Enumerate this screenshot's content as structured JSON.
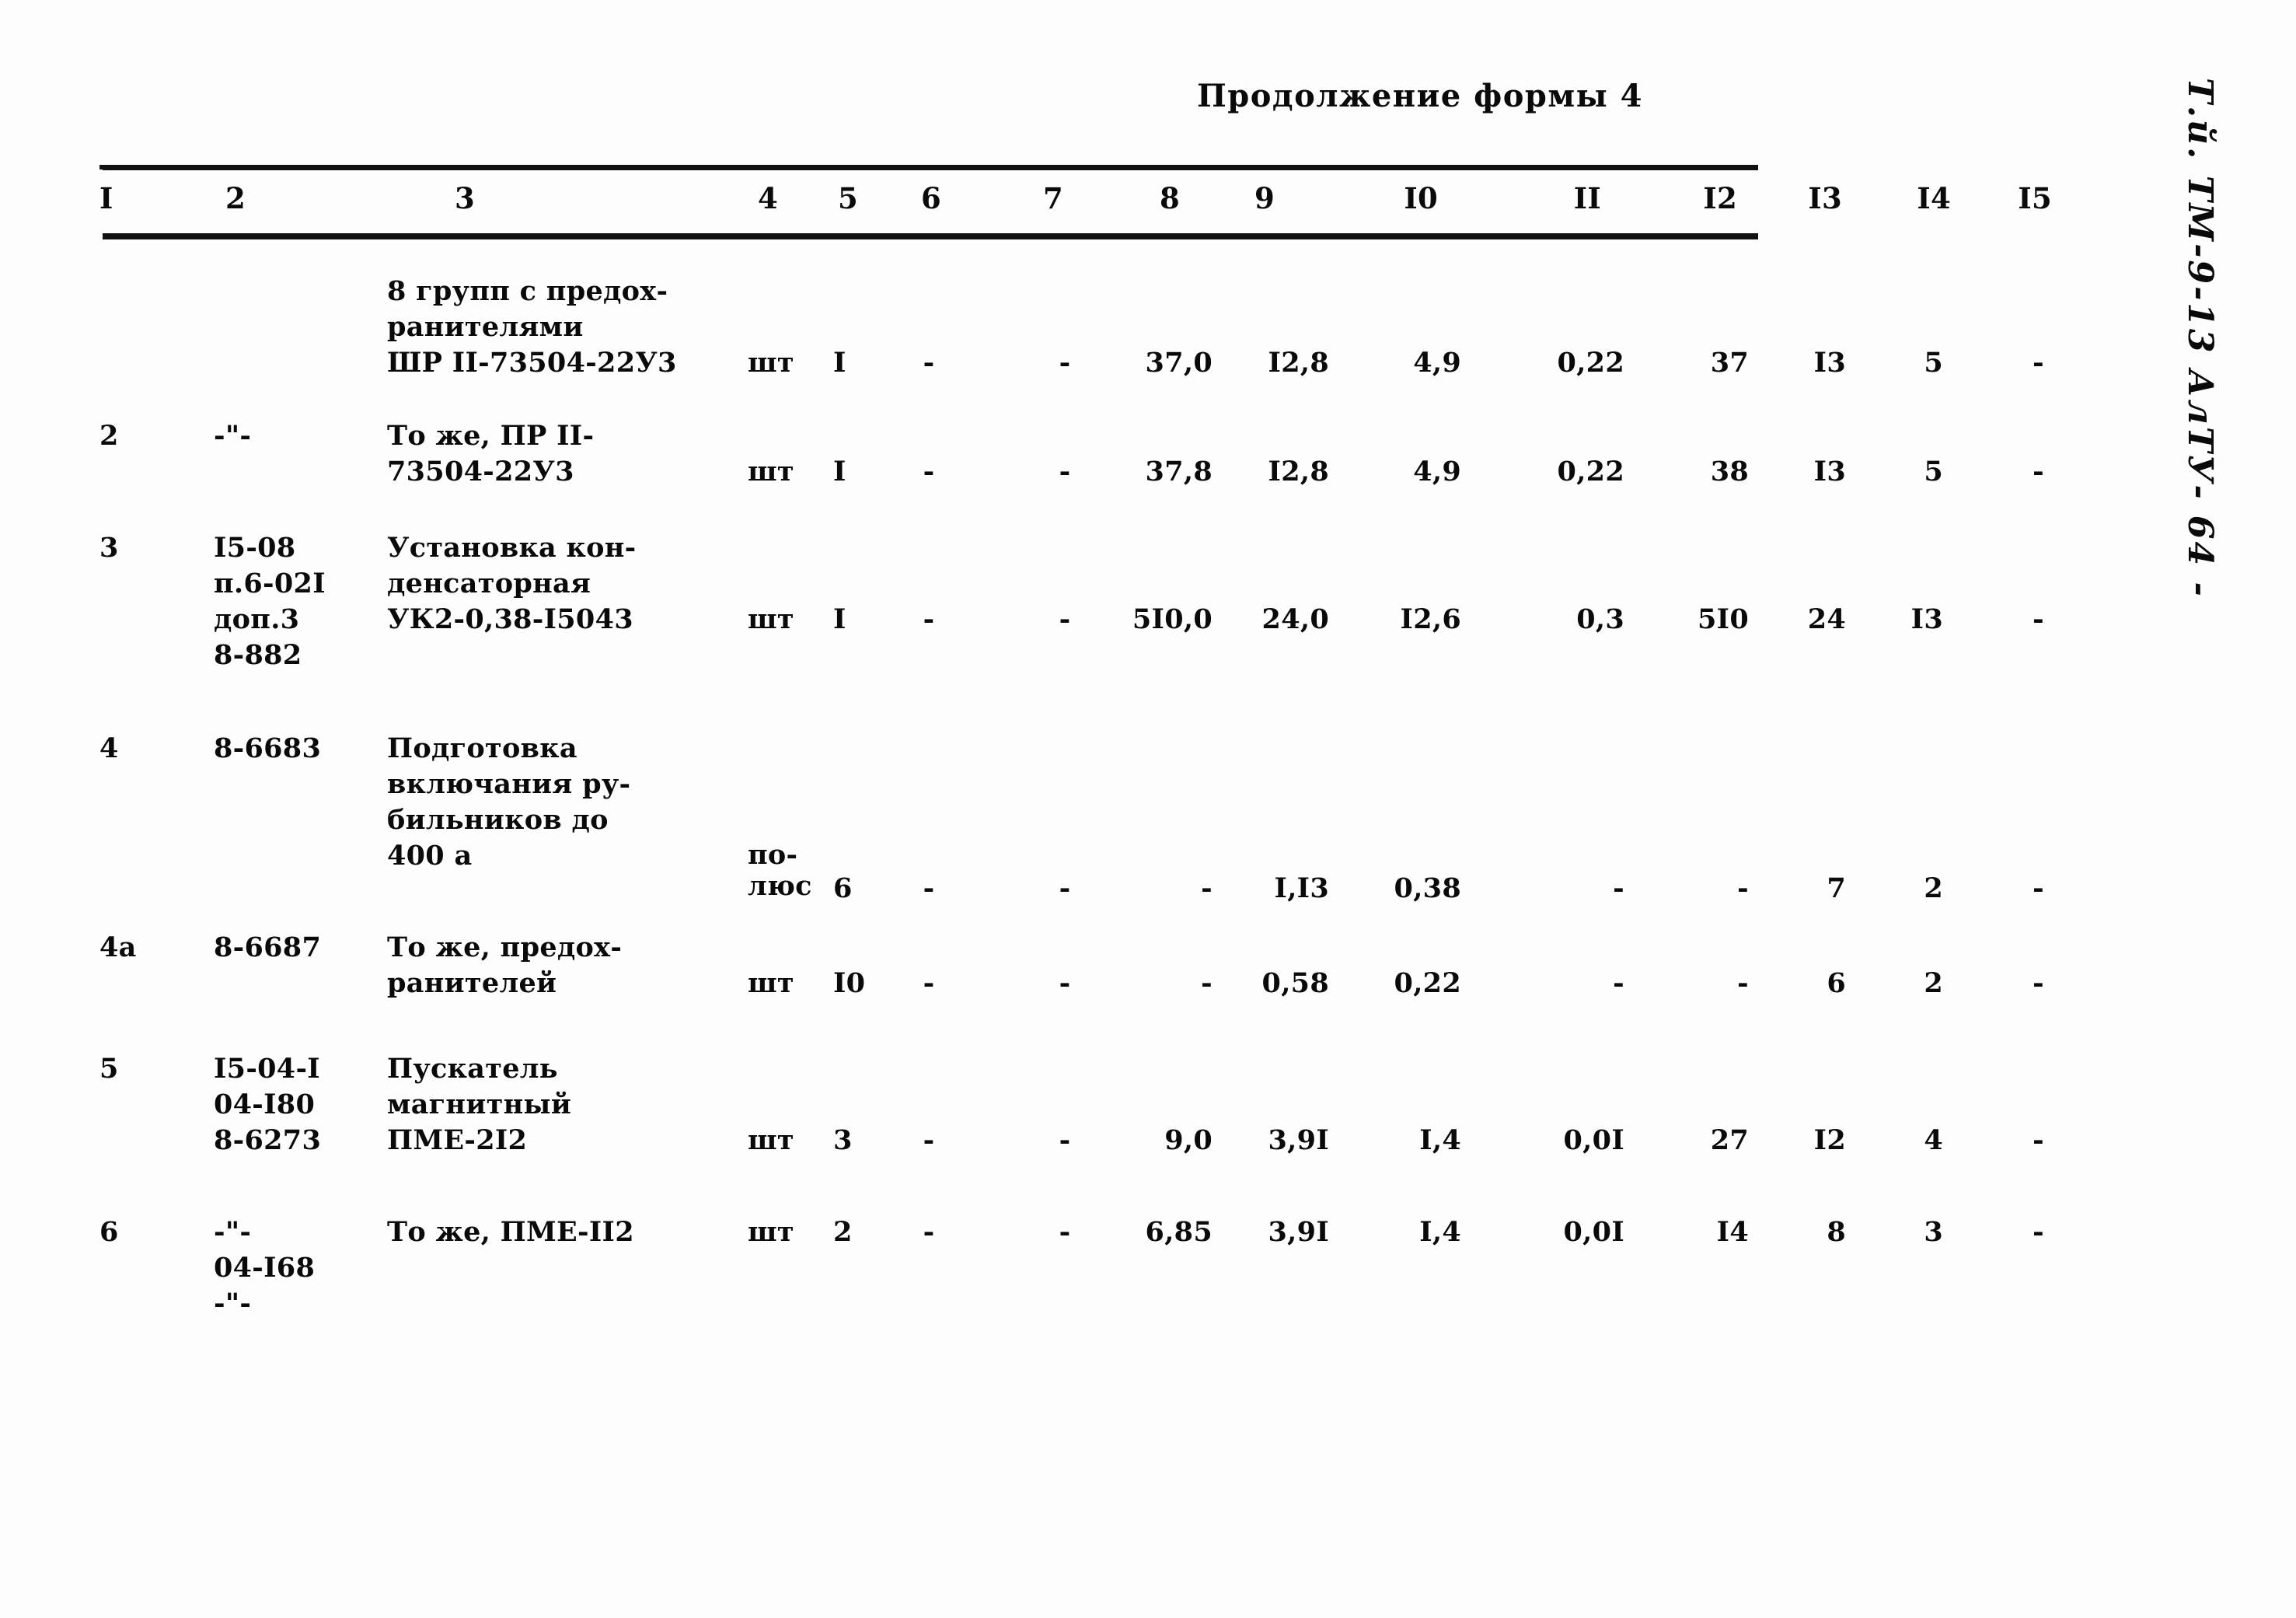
{
  "document": {
    "continuation_header": "Продолжение формы 4",
    "margin_note": "Т.й. ТМ-9-13  АлТУ- 64 -"
  },
  "table": {
    "column_numbers": [
      "I",
      "2",
      "3",
      "4",
      "5",
      "6",
      "7",
      "8",
      "9",
      "I0",
      "II",
      "I2",
      "I3",
      "I4",
      "I5"
    ],
    "rows": [
      {
        "c1": "",
        "c2": "",
        "c3": "8 групп с предох-\nранителями\nШР II-73504-22У3",
        "c4": "шт",
        "c5": "I",
        "c6": "-",
        "c7": "-",
        "c8": "37,0",
        "c9": "I2,8",
        "c10": "4,9",
        "c11": "0,22",
        "c12": "37",
        "c13": "I3",
        "c14": "5",
        "c15": "-"
      },
      {
        "c1": "2",
        "c2": "-\"-",
        "c3": "То же, ПР II-\n73504-22У3",
        "c4": "шт",
        "c5": "I",
        "c6": "-",
        "c7": "-",
        "c8": "37,8",
        "c9": "I2,8",
        "c10": "4,9",
        "c11": "0,22",
        "c12": "38",
        "c13": "I3",
        "c14": "5",
        "c15": "-"
      },
      {
        "c1": "3",
        "c2": "I5-08\nп.6-02I\nдоп.3\n8-882",
        "c3": "Установка кон-\nденсаторная\nУК2-0,38-I5043",
        "c4": "шт",
        "c5": "I",
        "c6": "-",
        "c7": "-",
        "c8": "5I0,0",
        "c9": "24,0",
        "c10": "I2,6",
        "c11": "0,3",
        "c12": "5I0",
        "c13": "24",
        "c14": "I3",
        "c15": "-"
      },
      {
        "c1": "4",
        "c2": "8-6683",
        "c3": "Подготовка\nвключания ру-\nбильников до\n400 а",
        "c4": "по-\nлюс",
        "c5": "6",
        "c6": "-",
        "c7": "-",
        "c8": "-",
        "c9": "I,I3",
        "c10": "0,38",
        "c11": "-",
        "c12": "-",
        "c13": "7",
        "c14": "2",
        "c15": "-"
      },
      {
        "c1": "4а",
        "c2": "8-6687",
        "c3": "То же, предох-\nранителей",
        "c4": "шт",
        "c5": "I0",
        "c6": "-",
        "c7": "-",
        "c8": "-",
        "c9": "0,58",
        "c10": "0,22",
        "c11": "-",
        "c12": "-",
        "c13": "6",
        "c14": "2",
        "c15": "-"
      },
      {
        "c1": "5",
        "c2": "I5-04-I\n04-I80\n8-6273",
        "c3": "Пускатель\nмагнитный\nПМЕ-2I2",
        "c4": "шт",
        "c5": "3",
        "c6": "-",
        "c7": "-",
        "c8": "9,0",
        "c9": "3,9I",
        "c10": "I,4",
        "c11": "0,0I",
        "c12": "27",
        "c13": "I2",
        "c14": "4",
        "c15": "-"
      },
      {
        "c1": "6",
        "c2": "-\"-\n04-I68\n-\"-",
        "c3": "То же, ПМЕ-II2",
        "c4": "шт",
        "c5": "2",
        "c6": "-",
        "c7": "-",
        "c8": "6,85",
        "c9": "3,9I",
        "c10": "I,4",
        "c11": "0,0I",
        "c12": "I4",
        "c13": "8",
        "c14": "3",
        "c15": "-"
      }
    ]
  }
}
